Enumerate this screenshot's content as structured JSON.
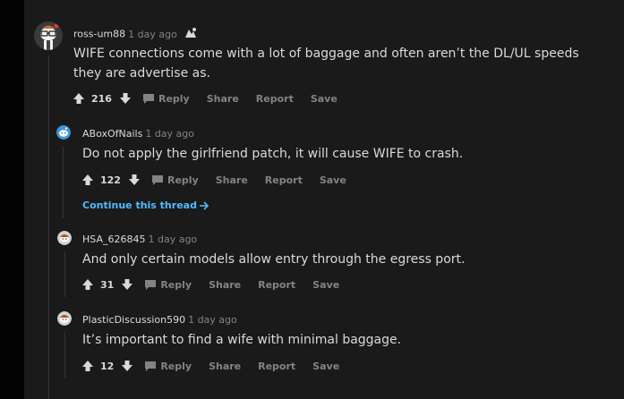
{
  "comments": [
    {
      "author": "ross-um88",
      "time": "1 day ago",
      "body": "WIFE connections come with a lot of baggage and often aren’t the DL/UL speeds they are advertise as.",
      "score": "216",
      "actions": {
        "reply": "Reply",
        "share": "Share",
        "report": "Report",
        "save": "Save"
      }
    },
    {
      "author": "ABoxOfNails",
      "time": "1 day ago",
      "body": "Do not apply the girlfriend patch, it will cause WIFE to crash.",
      "score": "122",
      "actions": {
        "reply": "Reply",
        "share": "Share",
        "report": "Report",
        "save": "Save"
      }
    },
    {
      "author": "HSA_626845",
      "time": "1 day ago",
      "body": "And only certain models allow entry through the egress port.",
      "score": "31",
      "actions": {
        "reply": "Reply",
        "share": "Share",
        "report": "Report",
        "save": "Save"
      }
    },
    {
      "author": "PlasticDiscussion590",
      "time": "1 day ago",
      "body": "It’s important to find a wife with minimal baggage.",
      "score": "12",
      "actions": {
        "reply": "Reply",
        "share": "Share",
        "report": "Report",
        "save": "Save"
      }
    }
  ],
  "continue_thread": "Continue this thread",
  "colors": {
    "background": "#1a1a1b",
    "text": "#d7dadc",
    "muted": "#818384",
    "link": "#4fbcff",
    "thread_line": "#343536"
  }
}
